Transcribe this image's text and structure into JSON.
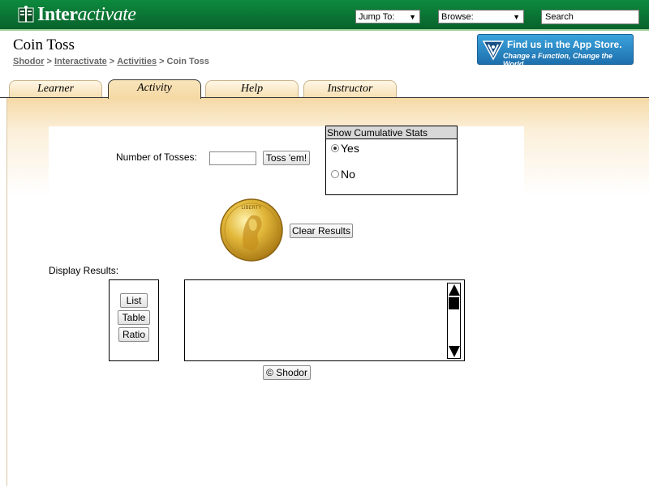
{
  "header": {
    "brand_bold": "Inter",
    "brand_italic": "activate",
    "jump_to": "Jump To:",
    "browse": "Browse:",
    "search": "Search"
  },
  "page": {
    "title": "Coin Toss",
    "breadcrumb": [
      "Shodor",
      "Interactivate",
      "Activities",
      "Coin Toss"
    ]
  },
  "app_store": {
    "line1": "Find us in the App Store.",
    "line2": "Change a Function, Change the World"
  },
  "tabs": [
    {
      "label": "Learner",
      "active": false
    },
    {
      "label": "Activity",
      "active": true
    },
    {
      "label": "Help",
      "active": false
    },
    {
      "label": "Instructor",
      "active": false
    }
  ],
  "activity": {
    "tosses_label": "Number of Tosses:",
    "tosses_value": "",
    "toss_button": "Toss 'em!",
    "stats_title": "Show Cumulative Stats",
    "stats_options": [
      {
        "label": "Yes",
        "selected": true
      },
      {
        "label": "No",
        "selected": false
      }
    ],
    "clear_button": "Clear Results",
    "coin_text": "LIBERTY",
    "display_label": "Display Results:",
    "display_buttons": [
      "List",
      "Table",
      "Ratio"
    ],
    "results_text": "",
    "copyright_button": "© Shodor"
  },
  "colors": {
    "header_green": "#0d8a3e",
    "tab_tan": "#f6dfb2",
    "content_tan": "#f5d9a6",
    "app_store_blue": "#1d6fad",
    "coin_gold": "#d4a82a"
  }
}
